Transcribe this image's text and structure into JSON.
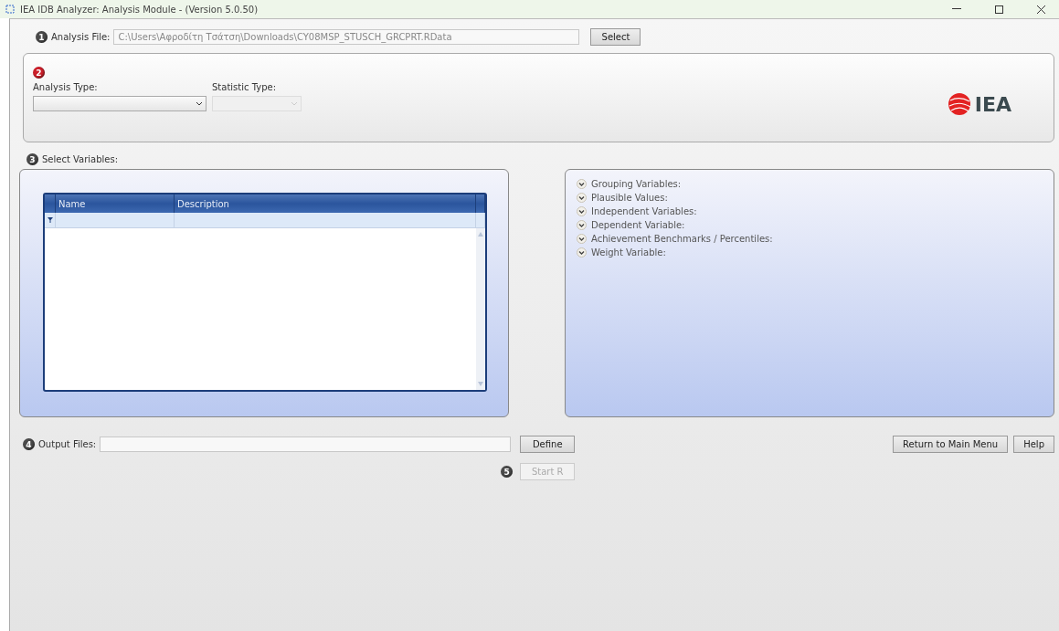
{
  "window": {
    "title": "IEA IDB Analyzer: Analysis Module - (Version 5.0.50)"
  },
  "analysis_file": {
    "step": {
      "number": "1",
      "color": "#4a4a4a"
    },
    "label": "Analysis File:",
    "value": "C:\\Users\\Αφροδίτη Τσάτση\\Downloads\\CY08MSP_STUSCH_GRCPRT.RData",
    "button": "Select"
  },
  "analysis": {
    "step": {
      "number": "2",
      "color": "#cc1f2a"
    },
    "analysis_type": {
      "label": "Analysis Type:",
      "disabled": false
    },
    "statistic_type": {
      "label": "Statistic Type:",
      "disabled": true
    },
    "logo": "IEA"
  },
  "select_variables": {
    "step": {
      "number": "3",
      "color": "#4a4a4a"
    },
    "label": "Select Variables:",
    "table": {
      "columns": [
        "Name",
        "Description"
      ]
    },
    "sections": [
      {
        "label": "Grouping Variables:",
        "expanded": false
      },
      {
        "label": "Plausible Values:",
        "expanded": false
      },
      {
        "label": "Independent Variables:",
        "expanded": false
      },
      {
        "label": "Dependent Variable:",
        "expanded": false
      },
      {
        "label": "Achievement Benchmarks / Percentiles:",
        "expanded": false
      },
      {
        "label": "Weight Variable:",
        "expanded": false
      }
    ]
  },
  "output": {
    "step": {
      "number": "4",
      "color": "#4a4a4a"
    },
    "label": "Output Files:",
    "button": "Define"
  },
  "start": {
    "step": {
      "number": "5",
      "color": "#4a4a4a"
    },
    "label": "Start R",
    "disabled": true
  },
  "buttons": [
    "Return to Main Menu",
    "Help"
  ]
}
